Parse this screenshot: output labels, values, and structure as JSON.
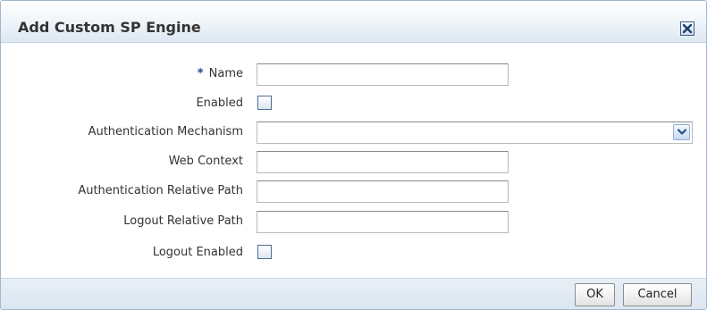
{
  "dialog": {
    "title": "Add Custom SP Engine",
    "close_icon": "close-icon"
  },
  "form": {
    "required_marker": "*",
    "name": {
      "label": "Name",
      "value": ""
    },
    "enabled": {
      "label": "Enabled",
      "checked": false
    },
    "auth_mechanism": {
      "label": "Authentication Mechanism",
      "value": "",
      "dropdown_icon": "chevron-down-icon"
    },
    "web_context": {
      "label": "Web Context",
      "value": ""
    },
    "auth_relative_path": {
      "label": "Authentication Relative Path",
      "value": ""
    },
    "logout_relative_path": {
      "label": "Logout Relative Path",
      "value": ""
    },
    "logout_enabled": {
      "label": "Logout Enabled",
      "checked": false
    }
  },
  "footer": {
    "ok_label": "OK",
    "cancel_label": "Cancel"
  },
  "colors": {
    "title_text": "#333333",
    "required_marker": "#1e3f8a",
    "border_accent": "#9fb6cd",
    "header_gradient_end": "#dde8f2"
  }
}
